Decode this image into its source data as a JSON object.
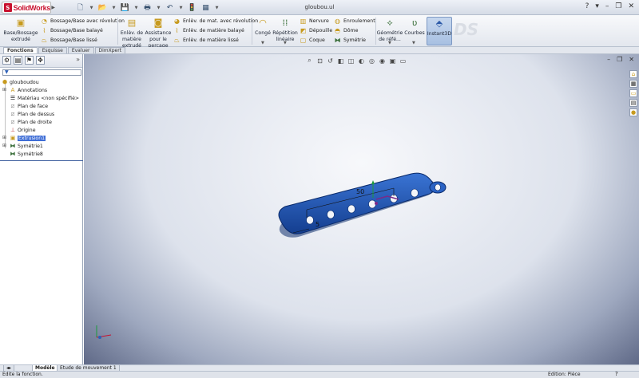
{
  "app": {
    "brand": "SolidWorks",
    "logo_mark": "S",
    "title": "gloubou.ul"
  },
  "ribbon": {
    "boss_extrude": "Base/Bossage extrudé",
    "boss_revolve": "Bossage/Base avec révolution",
    "boss_sweep": "Bossage/Base balayé",
    "boss_loft": "Bossage/Base lissé",
    "cut_extrude": "Enlèv. de matière extrudé",
    "hole_wizard": "Assistance pour le perçage",
    "cut_revolve": "Enlèv. de mat. avec révolution",
    "cut_sweep": "Enlèv. de matière balayé",
    "cut_loft": "Enlèv. de matière lissé",
    "fillet": "Congé",
    "linear_pattern": "Répétition linéaire",
    "rib": "Nervure",
    "draft": "Dépouille",
    "shell": "Coque",
    "wrap": "Enroulement",
    "dome": "Dôme",
    "mirror": "Symétrie",
    "ref_geometry": "Géométrie de réfé...",
    "curves": "Courbes",
    "instant3d": "Instant3D"
  },
  "tabs": [
    {
      "label": "Fonctions"
    },
    {
      "label": "Esquisse"
    },
    {
      "label": "Evaluer"
    },
    {
      "label": "DimXpert"
    }
  ],
  "tree": {
    "root": "glouboudou",
    "items": [
      {
        "label": "Annotations"
      },
      {
        "label": "Matériau <non spécifié>"
      },
      {
        "label": "Plan de face"
      },
      {
        "label": "Plan de dessus"
      },
      {
        "label": "Plan de droite"
      },
      {
        "label": "Origine"
      },
      {
        "label": "Extrusion1"
      },
      {
        "label": "Symétrie1"
      },
      {
        "label": "Symétrie8"
      }
    ]
  },
  "model": {
    "dim_length": "50",
    "dim_small": "5",
    "part_color": "#1f55b8"
  },
  "bottom_tabs": [
    "Modèle",
    "Etude de mouvement 1"
  ],
  "status": {
    "left": "Edite la fonction.",
    "right": "Edition: Pièce"
  },
  "colors": {
    "accent": "#3e6dd6",
    "brand": "#c8102e"
  }
}
